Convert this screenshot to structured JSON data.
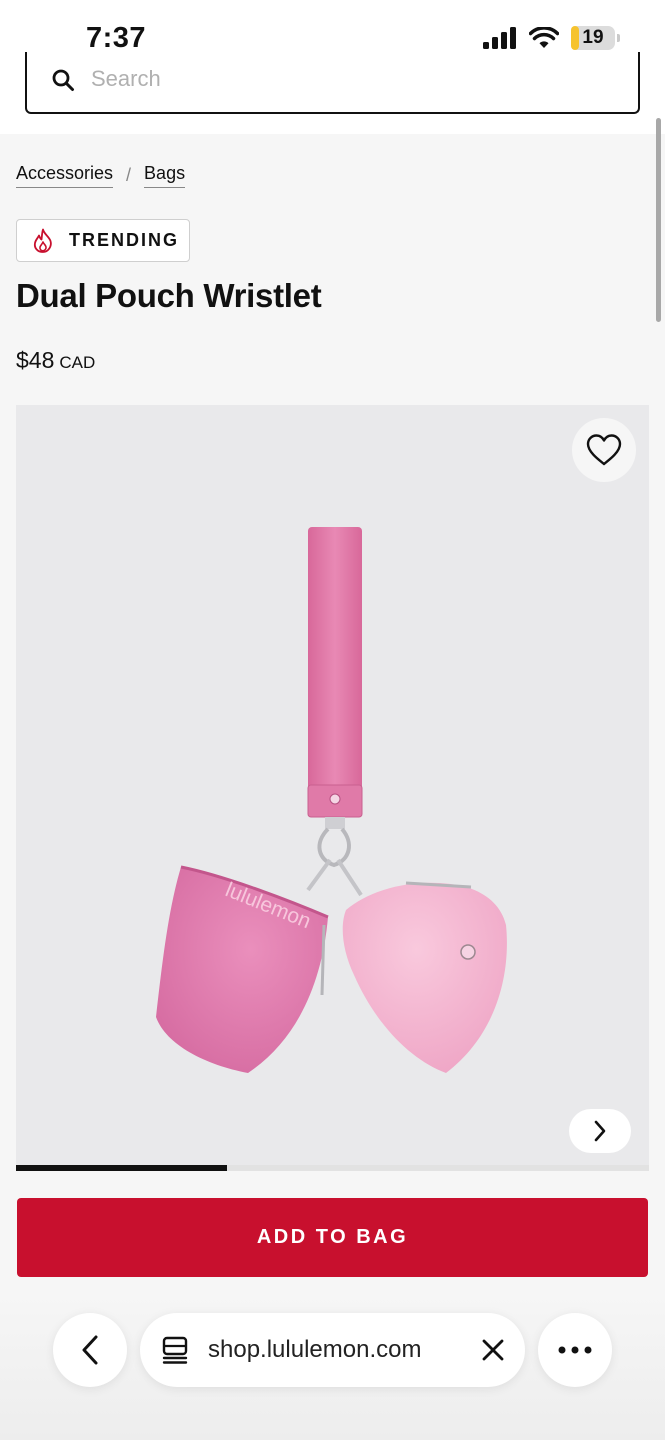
{
  "status_bar": {
    "time": "7:37",
    "battery_level": "19",
    "battery_fraction": 0.19
  },
  "search": {
    "placeholder": "Search"
  },
  "breadcrumb": {
    "items": [
      "Accessories",
      "Bags"
    ],
    "separator": "/"
  },
  "badge": {
    "label": "TRENDING",
    "icon": "flame-icon",
    "icon_color": "#c8102e"
  },
  "product": {
    "title": "Dual Pouch Wristlet",
    "price": "$48",
    "currency": "CAD",
    "image_brand_text": "lululemon",
    "image_colors": {
      "strap": "#e07aa8",
      "pouch_left": "#e27fb0",
      "pouch_right": "#f2b3cf"
    }
  },
  "carousel": {
    "progress_fraction": 0.333
  },
  "cta": {
    "add_to_bag": "ADD TO BAG",
    "color": "#c8102e"
  },
  "browser": {
    "url": "shop.lululemon.com",
    "icons": [
      "back-icon",
      "tabs-icon",
      "close-icon",
      "more-icon"
    ]
  }
}
